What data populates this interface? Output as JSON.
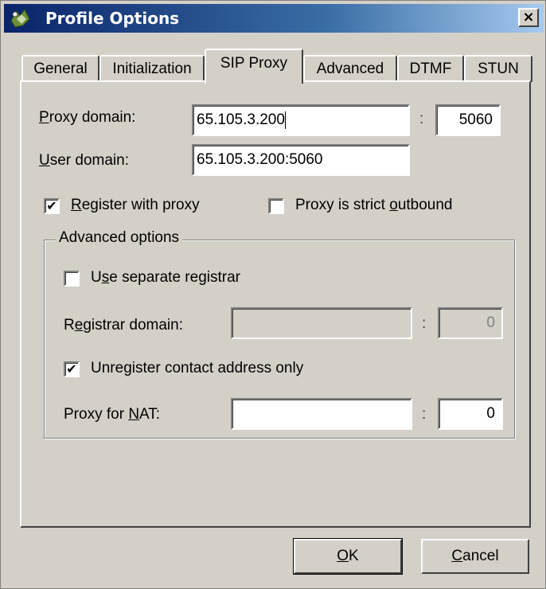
{
  "window": {
    "title": "Profile Options",
    "close_glyph": "×"
  },
  "tabs": [
    "General",
    "Initialization",
    "SIP Proxy",
    "Advanced",
    "DTMF",
    "STUN"
  ],
  "active_tab": "SIP Proxy",
  "proxy": {
    "domain_label": {
      "mn": "P",
      "rest": "roxy domain:"
    },
    "domain_value": "65.105.3.200",
    "port_value": "5060",
    "user_label": {
      "mn": "U",
      "rest": "ser domain:"
    },
    "user_value": "65.105.3.200:5060",
    "colon": ":"
  },
  "register": {
    "pre": "",
    "mn": "R",
    "rest": "egister with proxy",
    "checked": "✔"
  },
  "strict": {
    "pre": "Proxy is strict ",
    "mn": "o",
    "rest": "utbound",
    "checked": ""
  },
  "advanced": {
    "title": "Advanced options",
    "separate": {
      "pre": "U",
      "mn": "s",
      "rest": "e separate registrar",
      "checked": ""
    },
    "registrar_label": {
      "pre": "R",
      "mn": "e",
      "rest": "gistrar domain:"
    },
    "registrar_value": "",
    "registrar_port": "0",
    "unregister": {
      "pre": "Unre",
      "mn": "g",
      "rest": "ister contact address only",
      "checked": "✔"
    },
    "nat_label": {
      "pre": "Proxy for ",
      "mn": "N",
      "rest": "AT:"
    },
    "nat_value": "",
    "nat_port": "0"
  },
  "buttons": {
    "ok": {
      "mn": "O",
      "rest": "K"
    },
    "cancel": {
      "mn": "C",
      "rest": "ancel"
    }
  },
  "colors": {
    "face": "#d4d0c8",
    "title_start": "#0a246a",
    "title_end": "#a6caf0",
    "disabled_text": "#808080"
  }
}
